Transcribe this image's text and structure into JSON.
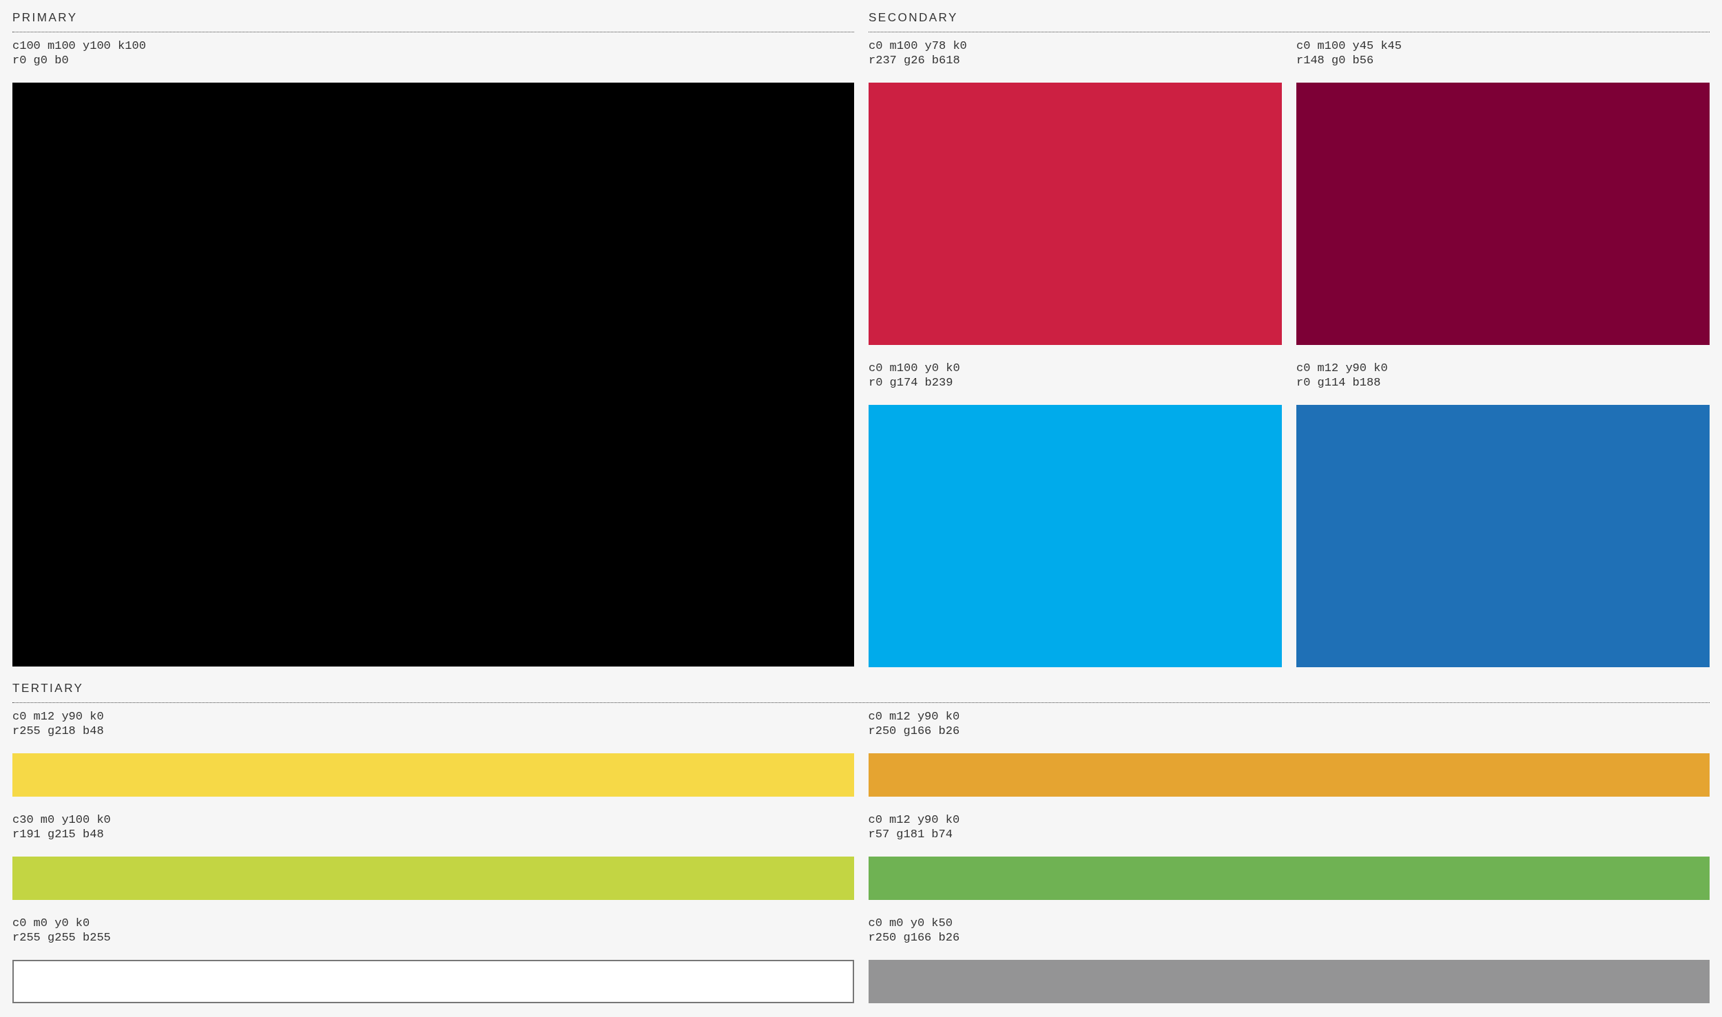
{
  "primary": {
    "title": "PRIMARY",
    "swatches": [
      {
        "cmyk": "c100 m100 y100 k100",
        "rgb": "r0 g0 b0",
        "color": "#000000"
      }
    ]
  },
  "secondary": {
    "title": "SECONDARY",
    "swatches": [
      {
        "cmyk": "c0 m100 y78 k0",
        "rgb": "r237 g26 b618",
        "color": "#cc2042"
      },
      {
        "cmyk": "c0 m100 y45 k45",
        "rgb": "r148 g0 b56",
        "color": "#7d0036"
      },
      {
        "cmyk": "c0 m100 y0 k0",
        "rgb": "r0 g174 b239",
        "color": "#00abeb"
      },
      {
        "cmyk": "c0 m12 y90 k0",
        "rgb": "r0 g114 b188",
        "color": "#1f70b6"
      }
    ]
  },
  "tertiary": {
    "title": "TERTIARY",
    "swatches": [
      {
        "cmyk": "c0 m12 y90 k0",
        "rgb": "r255 g218 b48",
        "color": "#f6d947",
        "outlined": false
      },
      {
        "cmyk": "c0 m12 y90 k0",
        "rgb": "r250 g166 b26",
        "color": "#e5a431",
        "outlined": false
      },
      {
        "cmyk": "c30 m0 y100 k0",
        "rgb": "r191 g215 b48",
        "color": "#c3d543",
        "outlined": false
      },
      {
        "cmyk": "c0 m12 y90 k0",
        "rgb": "r57 g181 b74",
        "color": "#6fb253",
        "outlined": false
      },
      {
        "cmyk": "c0 m0 y0 k0",
        "rgb": "r255 g255 b255",
        "color": "#ffffff",
        "outlined": true
      },
      {
        "cmyk": "c0 m0 y0 k50",
        "rgb": "r250 g166 b26",
        "color": "#949495",
        "outlined": false
      }
    ]
  }
}
